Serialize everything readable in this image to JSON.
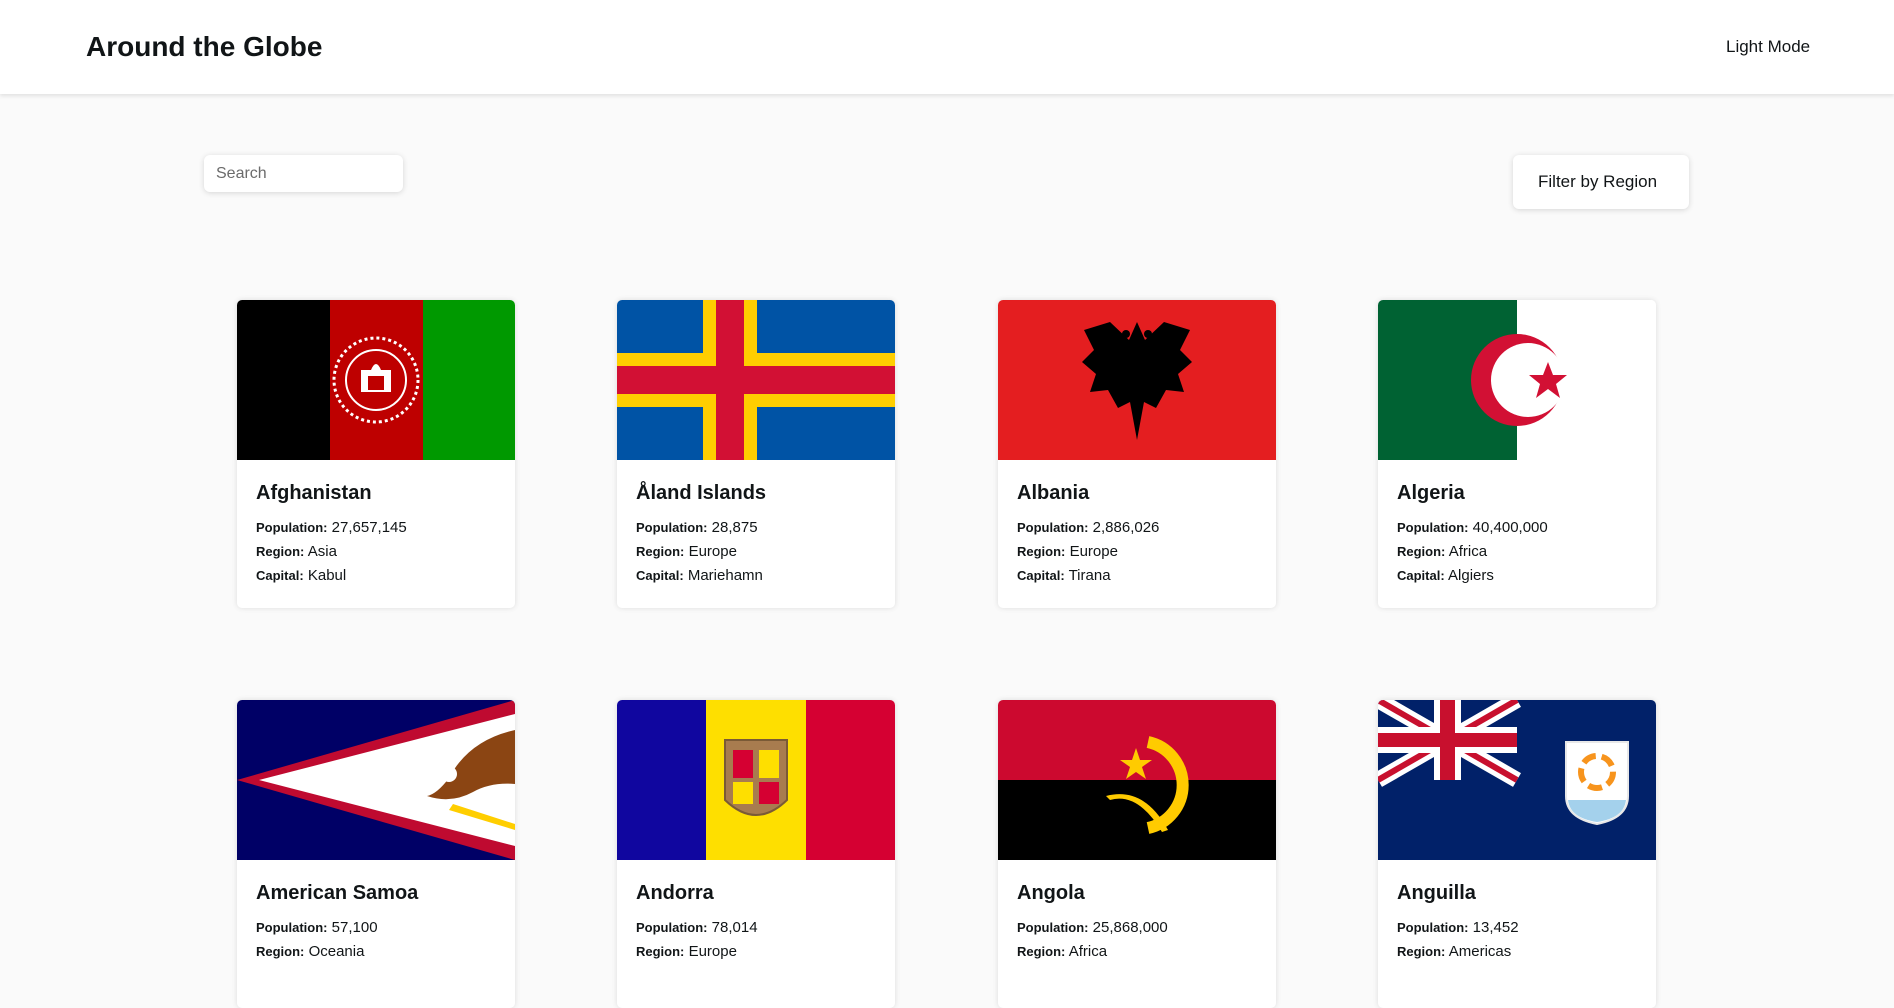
{
  "header": {
    "title": "Around the Globe",
    "theme_toggle": "Light Mode"
  },
  "search": {
    "placeholder": "Search",
    "value": ""
  },
  "filter": {
    "label": "Filter by Region"
  },
  "labels": {
    "population": "Population:",
    "region": "Region:",
    "capital": "Capital:"
  },
  "countries": [
    {
      "name": "Afghanistan",
      "population": "27,657,145",
      "region": "Asia",
      "capital": "Kabul",
      "flag_icon": "afghanistan-flag-icon"
    },
    {
      "name": "Åland Islands",
      "population": "28,875",
      "region": "Europe",
      "capital": "Mariehamn",
      "flag_icon": "aland-islands-flag-icon"
    },
    {
      "name": "Albania",
      "population": "2,886,026",
      "region": "Europe",
      "capital": "Tirana",
      "flag_icon": "albania-flag-icon"
    },
    {
      "name": "Algeria",
      "population": "40,400,000",
      "region": "Africa",
      "capital": "Algiers",
      "flag_icon": "algeria-flag-icon"
    },
    {
      "name": "American Samoa",
      "population": "57,100",
      "region": "Oceania",
      "flag_icon": "american-samoa-flag-icon"
    },
    {
      "name": "Andorra",
      "population": "78,014",
      "region": "Europe",
      "flag_icon": "andorra-flag-icon"
    },
    {
      "name": "Angola",
      "population": "25,868,000",
      "region": "Africa",
      "flag_icon": "angola-flag-icon"
    },
    {
      "name": "Anguilla",
      "population": "13,452",
      "region": "Americas",
      "flag_icon": "anguilla-flag-icon"
    }
  ]
}
